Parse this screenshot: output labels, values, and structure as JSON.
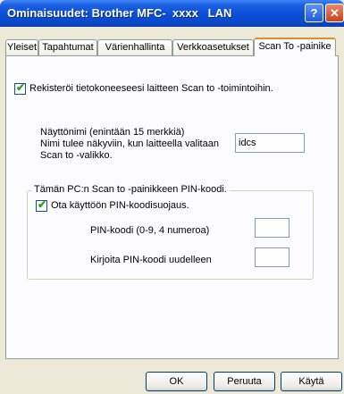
{
  "window": {
    "title": "Ominaisuudet: Brother MFC-  xxxx   LAN",
    "help_glyph": "?",
    "close_glyph": "✕"
  },
  "tabs": [
    {
      "label": "Yleiset"
    },
    {
      "label": "Tapahtumat"
    },
    {
      "label": "Värienhallinta"
    },
    {
      "label": "Verkkoasetukset"
    },
    {
      "label": "Scan To -painike",
      "active": true
    }
  ],
  "register": {
    "checked": true,
    "label": "Rekisteröi tietokoneeseesi laitteen Scan to -toimintoihin."
  },
  "display_name": {
    "line1": "Näyttönimi (enintään 15 merkkiä)",
    "line2": "Nimi tulee näkyviin, kun laitteella valitaan",
    "line3": "Scan to -valikko.",
    "value": "idcs"
  },
  "pin_group": {
    "title": "Tämän PC:n Scan to -painikkeen PIN-koodi.",
    "enable_checked": true,
    "enable_label": "Ota käyttöön PIN-koodisuojaus.",
    "pin_label": "PIN-koodi (0-9, 4 numeroa)",
    "pin_value": "",
    "confirm_label": "Kirjoita PIN-koodi uudelleen",
    "confirm_value": ""
  },
  "buttons": {
    "ok": "OK",
    "cancel": "Peruuta",
    "apply": "Käytä"
  }
}
